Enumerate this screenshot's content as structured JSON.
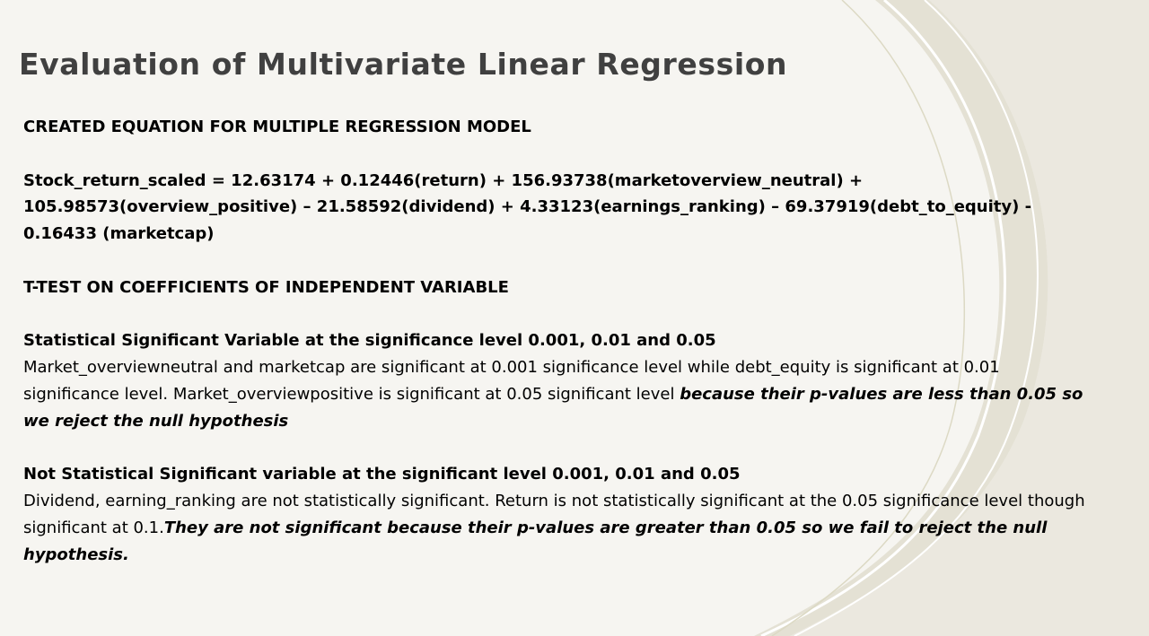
{
  "slide": {
    "title": "Evaluation of Multivariate Linear Regression",
    "equation_section": {
      "heading": "CREATED EQUATION FOR MULTIPLE REGRESSION MODEL",
      "line1": "Stock_return_scaled = 12.63174 + 0.12446(return) + 156.93738(marketoverview_neutral) +",
      "line2": "105.98573(overview_positive) – 21.58592(dividend) + 4.33123(earnings_ranking) – 69.37919(debt_to_equity) -",
      "line3": "0.16433 (marketcap)"
    },
    "ttest_section": {
      "heading": "T-TEST ON COEFFICIENTS OF INDEPENDENT VARIABLE"
    },
    "significant_section": {
      "heading": "Statistical Significant Variable at the significance level 0.001, 0.01 and 0.05",
      "text": "Market_overviewneutral and marketcap are significant at 0.001 significance level while debt_equity is significant at 0.01 significance level. Market_overviewpositive is significant at 0.05 significant level ",
      "emphasis": "because their p-values are less than 0.05 so we reject the null hypothesis"
    },
    "not_significant_section": {
      "heading": "Not Statistical Significant variable at the significant level 0.001, 0.01 and 0.05",
      "text": "Dividend, earning_ranking are not statistically significant. Return is not statistically significant at the 0.05 significance level though significant at 0.1.",
      "emphasis": "They are not significant because their p-values are greater than 0.05 so we fail to reject the null hypothesis."
    }
  },
  "colors": {
    "background": "#f6f5f1",
    "title": "#404040",
    "decor_band": "#e9e6dc",
    "decor_curve": "#dcd9c4"
  }
}
